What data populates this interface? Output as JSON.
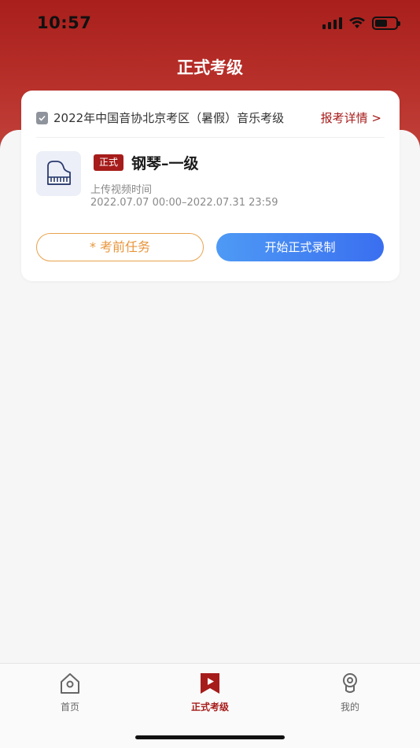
{
  "status": {
    "time": "10:57"
  },
  "header": {
    "title": "正式考级"
  },
  "card": {
    "exam_name": "2022年中国音协北京考区（暑假）音乐考级",
    "detail_link": "报考详情 >",
    "tag": "正式",
    "course": "钢琴–一级",
    "upload_label": "上传视频时间",
    "upload_range": "2022.07.07 00:00–2022.07.31 23:59",
    "task_button": "* 考前任务",
    "record_button": "开始正式录制"
  },
  "tabbar": {
    "items": [
      {
        "label": "首页",
        "icon": "home-icon",
        "active": false
      },
      {
        "label": "正式考级",
        "icon": "video-bookmark-icon",
        "active": true
      },
      {
        "label": "我的",
        "icon": "person-icon",
        "active": false
      }
    ]
  },
  "colors": {
    "brand_red": "#a61c1b",
    "accent_blue": "#3a6ff0",
    "accent_orange": "#e8953b"
  }
}
